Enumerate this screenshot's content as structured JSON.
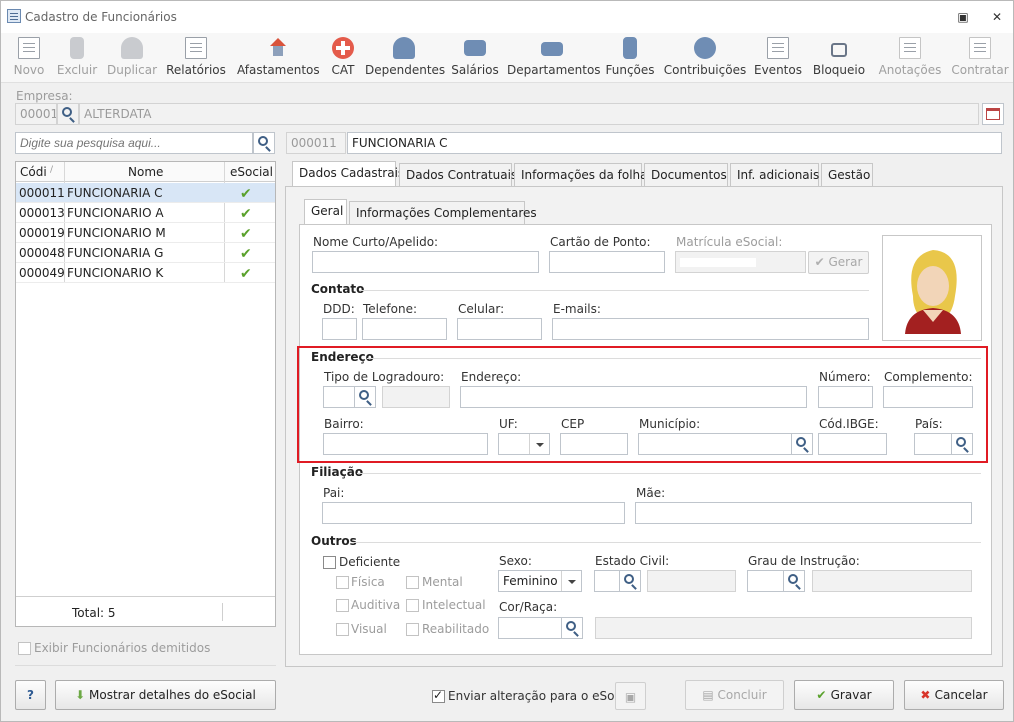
{
  "window": {
    "title": "Cadastro de Funcionários",
    "minimize_icon": "restore-icon",
    "close_icon": "close-icon"
  },
  "toolbar": {
    "novo": "Novo",
    "excluir": "Excluir",
    "duplicar": "Duplicar",
    "relatorios": "Relatórios",
    "afastamentos": "Afastamentos",
    "cat": "CAT",
    "dependentes": "Dependentes",
    "salarios": "Salários",
    "departamentos": "Departamentos",
    "funcoes": "Funções",
    "contribuicoes": "Contribuições",
    "eventos": "Eventos",
    "bloqueio": "Bloqueio",
    "anotacoes": "Anotações",
    "contratar": "Contratar"
  },
  "empresa": {
    "label": "Empresa:",
    "code": "00001",
    "name": "ALTERDATA"
  },
  "search": {
    "placeholder": "Digite sua pesquisa aqui..."
  },
  "selected": {
    "code": "000011",
    "name": "FUNCIONARIA C"
  },
  "grid": {
    "headers": {
      "code": "Códi",
      "name": "Nome",
      "esocial": "eSocial"
    },
    "rows": [
      {
        "code": "000011",
        "name": "FUNCIONARIA C"
      },
      {
        "code": "000013",
        "name": "FUNCIONARIO A"
      },
      {
        "code": "000019",
        "name": "FUNCIONARIO M"
      },
      {
        "code": "000048",
        "name": "FUNCIONARIA G"
      },
      {
        "code": "000049",
        "name": "FUNCIONARIO K"
      }
    ],
    "total": "Total: 5"
  },
  "exibir_demitidos": "Exibir Funcionários demitidos",
  "tabs": [
    "Dados Cadastrais",
    "Dados Contratuais",
    "Informações da folha",
    "Documentos",
    "Inf. adicionais",
    "Gestão"
  ],
  "subtabs": [
    "Geral",
    "Informações Complementares"
  ],
  "form": {
    "nome_curto": "Nome Curto/Apelido:",
    "cartao_ponto": "Cartão de Ponto:",
    "matricula": "Matrícula eSocial:",
    "gerar": "Gerar",
    "contato": "Contato",
    "ddd": "DDD:",
    "telefone": "Telefone:",
    "celular": "Celular:",
    "emails": "E-mails:",
    "endereco_section": "Endereço",
    "tipo_logradouro": "Tipo de Logradouro:",
    "endereco": "Endereço:",
    "numero": "Número:",
    "complemento": "Complemento:",
    "bairro": "Bairro:",
    "uf": "UF:",
    "cep": "CEP",
    "municipio": "Município:",
    "cod_ibge": "Cód.IBGE:",
    "pais": "País:",
    "filiacao": "Filiação",
    "pai": "Pai:",
    "mae": "Mãe:",
    "outros": "Outros",
    "deficiente": "Deficiente",
    "fisica": "Física",
    "mental": "Mental",
    "auditiva": "Auditiva",
    "intelectual": "Intelectual",
    "visual": "Visual",
    "reabilitado": "Reabilitado",
    "sexo": "Sexo:",
    "sexo_value": "Feminino",
    "estado_civil": "Estado Civil:",
    "grau_instrucao": "Grau de Instrução:",
    "cor_raca": "Cor/Raça:"
  },
  "footer": {
    "help": "?",
    "mostrar": "Mostrar detalhes do eSocial",
    "enviar": "Enviar alteração para o eSocial",
    "concluir": "Concluir",
    "gravar": "Gravar",
    "cancelar": "Cancelar"
  },
  "colors": {
    "accent_red": "#e01b24",
    "check_green": "#5aa12c",
    "selected_row": "#d8e6f6"
  }
}
